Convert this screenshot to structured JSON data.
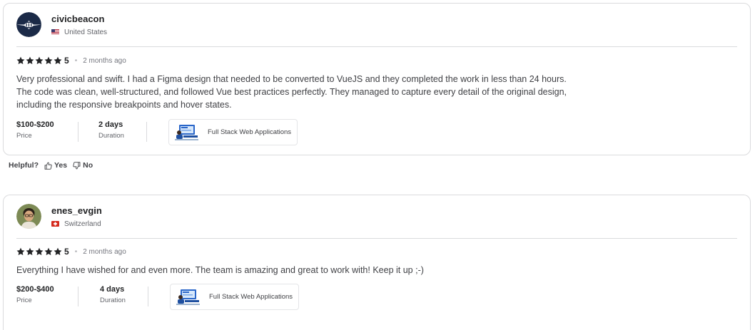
{
  "reviews": [
    {
      "username": "civicbeacon",
      "country": "United States",
      "flag": "us-flag",
      "rating": "5",
      "stars": 5,
      "time_ago": "2 months ago",
      "text_lines": [
        "Very professional and swift. I had a Figma design that needed to be converted to VueJS and they completed the work in less than 24 hours.",
        "The code was clean, well-structured, and followed Vue best practices perfectly. They managed to capture every detail of the original design,",
        "including the responsive breakpoints and hover states."
      ],
      "price": "$100-$200",
      "price_label": "Price",
      "duration": "2 days",
      "duration_label": "Duration",
      "gig_title": "Full Stack Web Applications"
    },
    {
      "username": "enes_evgin",
      "country": "Switzerland",
      "flag": "swiss-flag",
      "rating": "5",
      "stars": 5,
      "time_ago": "2 months ago",
      "text_lines": [
        "Everything I have wished for and even more. The team is amazing and great to work with! Keep it up ;-)"
      ],
      "price": "$200-$400",
      "price_label": "Price",
      "duration": "4 days",
      "duration_label": "Duration",
      "gig_title": "Full Stack Web Applications"
    }
  ],
  "helpful": {
    "label": "Helpful?",
    "yes": "Yes",
    "no": "No"
  },
  "colors": {
    "text": "#222325",
    "muted": "#62646a",
    "border": "#dadbdd",
    "star": "#222325"
  }
}
